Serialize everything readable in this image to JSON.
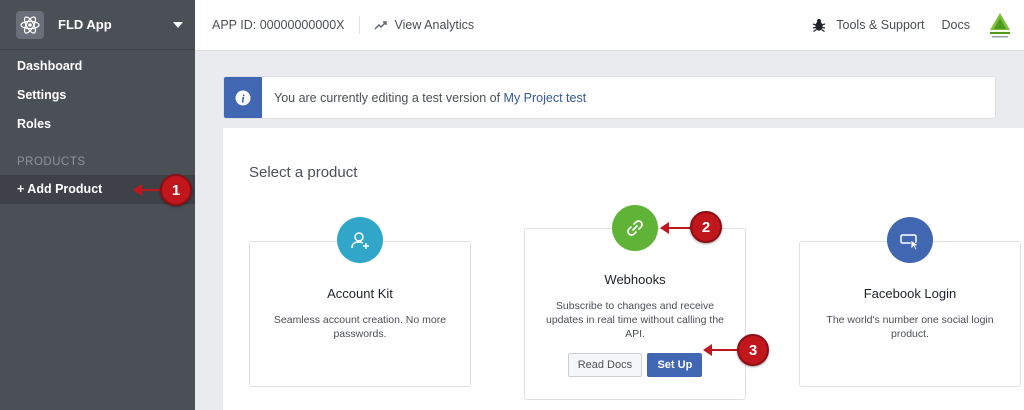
{
  "sidebar": {
    "app_name": "FLD App",
    "app_icon": "react-atom-icon",
    "items": [
      {
        "label": "Dashboard"
      },
      {
        "label": "Settings"
      },
      {
        "label": "Roles"
      }
    ],
    "section_label": "PRODUCTS",
    "add_product_label": "+ Add Product"
  },
  "topbar": {
    "app_id": "APP ID: 00000000000X",
    "analytics_label": "View Analytics",
    "tools_label": "Tools & Support",
    "docs_label": "Docs"
  },
  "notice": {
    "text": "You are currently editing a test version of ",
    "link": "My Project test"
  },
  "main": {
    "section_title": "Select a product",
    "products": [
      {
        "title": "Account Kit",
        "desc": "Seamless account creation. No more passwords.",
        "icon": "user-add-icon",
        "color": "#30a7c9"
      },
      {
        "title": "Webhooks",
        "desc": "Subscribe to changes and receive updates in real time without calling the API.",
        "icon": "link-icon",
        "color": "#5fb336",
        "read_docs_label": "Read Docs",
        "setup_label": "Set Up"
      },
      {
        "title": "Facebook Login",
        "desc": "The world's number one social login product.",
        "icon": "login-cursor-icon",
        "color": "#4267b2"
      }
    ]
  },
  "annotations": [
    {
      "number": "1"
    },
    {
      "number": "2"
    },
    {
      "number": "3"
    }
  ],
  "colors": {
    "sidebar_bg": "#4b4f56",
    "accent": "#4267b2",
    "annotation": "#c0161c"
  }
}
